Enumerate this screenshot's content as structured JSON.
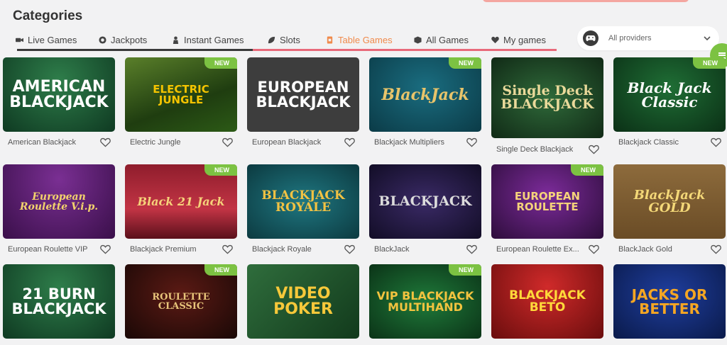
{
  "page": {
    "title": "Categories"
  },
  "tabs": [
    {
      "label": "Live Games",
      "icon": "video-camera-icon",
      "active": false
    },
    {
      "label": "Jackpots",
      "icon": "chip-icon",
      "active": false
    },
    {
      "label": "Instant Games",
      "icon": "person-icon",
      "active": false
    },
    {
      "label": "Slots",
      "icon": "leaf-icon",
      "active": false
    },
    {
      "label": "Table Games",
      "icon": "card-icon",
      "active": true
    },
    {
      "label": "All Games",
      "icon": "cube-icon",
      "active": false
    },
    {
      "label": "My games",
      "icon": "heart-icon",
      "active": false
    }
  ],
  "provider_select": {
    "value": "All providers",
    "icon": "gamepad-icon"
  },
  "new_badge": "NEW",
  "colors": {
    "accent": "#f08a4b",
    "new_badge": "#7cc242",
    "tab_underline": "#e86a7a"
  },
  "games": [
    {
      "name": "American Blackjack",
      "art": "AMERICAN BLACKJACK",
      "new": false
    },
    {
      "name": "Electric Jungle",
      "art": "ELECTRIC JUNGLE",
      "new": true
    },
    {
      "name": "European Blackjack",
      "art": "EUROPEAN BLACKJACK",
      "new": false
    },
    {
      "name": "Blackjack Multipliers",
      "art": "BlackJack",
      "new": true
    },
    {
      "name": "Single Deck Blackjack",
      "art": "Single Deck BLACKJACK",
      "new": false
    },
    {
      "name": "Blackjack Classic",
      "art": "Black Jack Classic",
      "new": true
    },
    {
      "name": "European Roulette VIP",
      "art": "European Roulette V.i.p.",
      "new": false
    },
    {
      "name": "Blackjack Premium",
      "art": "Black 21 Jack",
      "new": true
    },
    {
      "name": "Blackjack Royale",
      "art": "BLACKJACK ROYALE",
      "new": false
    },
    {
      "name": "BlackJack",
      "art": "BLACKJACK",
      "new": false
    },
    {
      "name": "European Roulette Ex...",
      "art": "EUROPEAN ROULETTE",
      "new": true
    },
    {
      "name": "BlackJack Gold",
      "art": "BlackJack GOLD",
      "new": false
    },
    {
      "name": "",
      "art": "21 BURN BLACKJACK",
      "new": false
    },
    {
      "name": "",
      "art": "ROULETTE CLASSIC",
      "new": true
    },
    {
      "name": "",
      "art": "VIDEO POKER",
      "new": false
    },
    {
      "name": "",
      "art": "VIP BLACKJACK MULTIHAND",
      "new": true
    },
    {
      "name": "",
      "art": "BLACKJACK BETO",
      "new": false
    },
    {
      "name": "",
      "art": "JACKS OR BETTER",
      "new": false
    }
  ]
}
